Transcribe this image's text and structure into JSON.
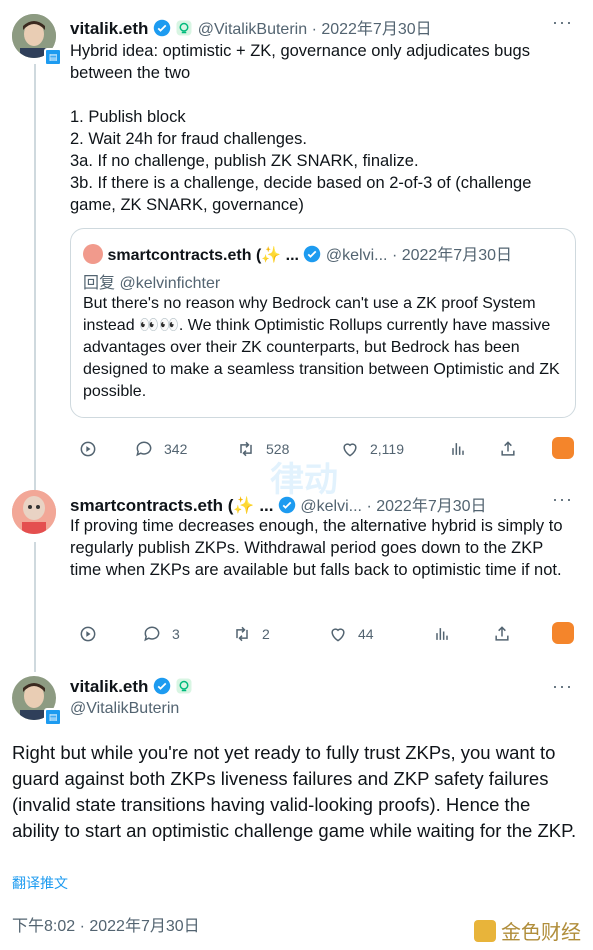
{
  "tweet1": {
    "name": "vitalik.eth",
    "handle": "@VitalikButerin",
    "date": "· 2022年7月30日",
    "body": "Hybrid idea: optimistic + ZK, governance only adjudicates bugs between the two\n\n1. Publish block\n2. Wait 24h for fraud challenges.\n3a. If no challenge, publish ZK SNARK, finalize.\n3b. If there is a challenge, decide based on 2-of-3 of (challenge game, ZK SNARK, governance)",
    "quote": {
      "name": "smartcontracts.eth (✨ ...",
      "handle": "@kelvi...",
      "date": "· 2022年7月30日",
      "reply_to": "回复 @kelvinfichter",
      "body": "But there's no reason why Bedrock can't use a ZK proof System instead 👀👀. We think Optimistic Rollups currently have massive advantages over their ZK counterparts, but Bedrock has been designed to make a seamless transition between Optimistic and ZK possible."
    },
    "actions": {
      "replies": "342",
      "retweets": "528",
      "likes": "2,119"
    }
  },
  "tweet2": {
    "name": "smartcontracts.eth (✨ ...",
    "handle": "@kelvi...",
    "date": "· 2022年7月30日",
    "body": "If proving time decreases enough, the alternative hybrid is simply to regularly publish ZKPs. Withdrawal period goes down to the ZKP time when ZKPs are available but falls back to optimistic time if not.",
    "actions": {
      "replies": "3",
      "retweets": "2",
      "likes": "44"
    }
  },
  "tweet3": {
    "name": "vitalik.eth",
    "handle": "@VitalikButerin",
    "body": "Right but while you're not yet ready to fully trust ZKPs, you want to guard against both ZKPs liveness failures and ZKP safety failures (invalid state transitions having valid-looking proofs). Hence the ability to start an optimistic challenge game while waiting for the ZKP.",
    "translate": "翻译推文",
    "timestamp": "下午8:02 · 2022年7月30日"
  },
  "watermark": {
    "center": "律动",
    "corner": "金色财经"
  },
  "colors": {
    "accent": "#1d9bf0",
    "muted": "#536471",
    "orange": "#f4852b",
    "green": "#00ba7c"
  }
}
